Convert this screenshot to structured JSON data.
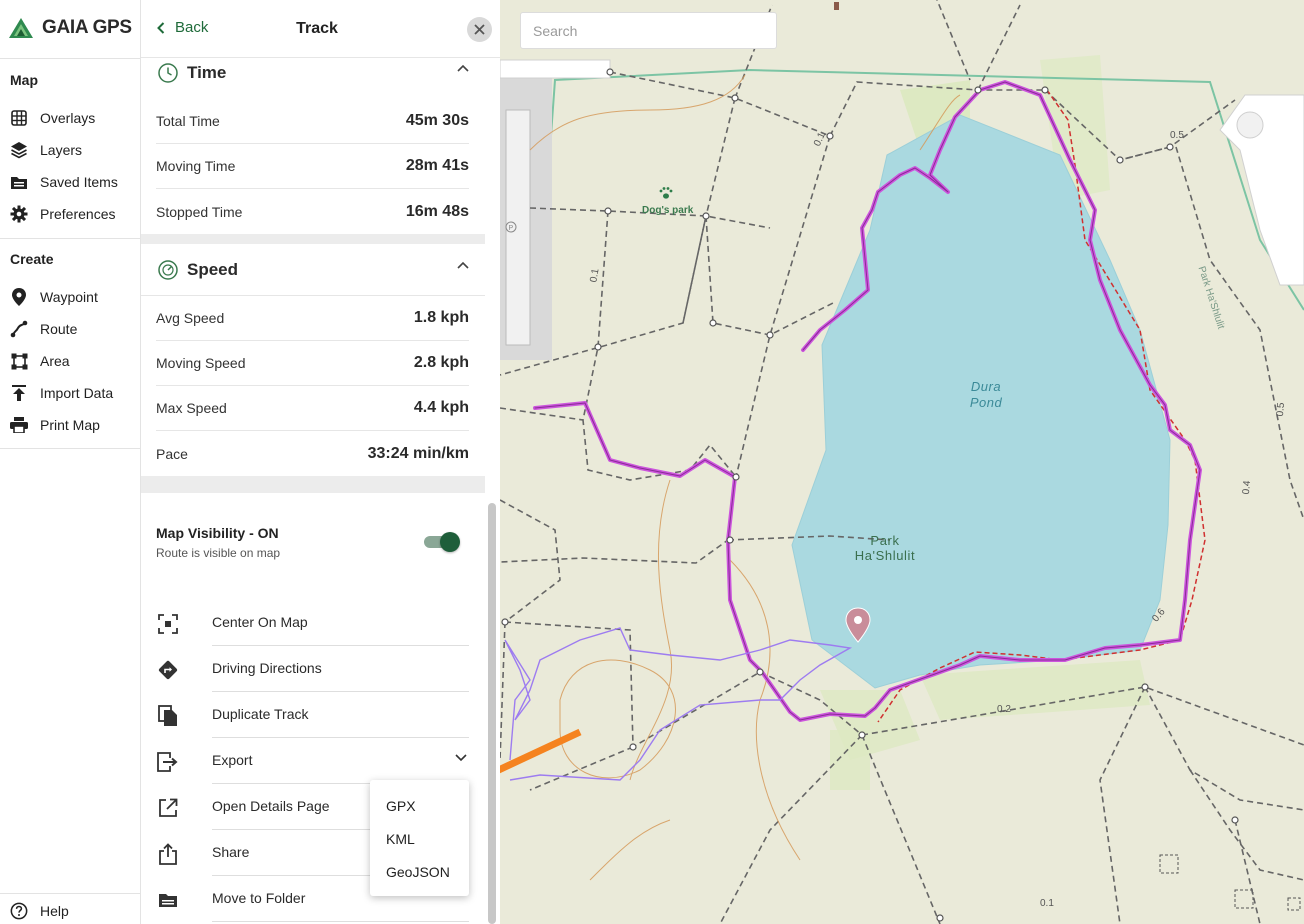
{
  "app": {
    "name": "GAIA GPS"
  },
  "sidebar": {
    "sections": [
      {
        "title": "Map",
        "items": [
          {
            "label": "Overlays",
            "icon": "overlays-icon"
          },
          {
            "label": "Layers",
            "icon": "layers-icon"
          },
          {
            "label": "Saved Items",
            "icon": "saved-items-icon"
          },
          {
            "label": "Preferences",
            "icon": "gear-icon"
          }
        ]
      },
      {
        "title": "Create",
        "items": [
          {
            "label": "Waypoint",
            "icon": "waypoint-icon"
          },
          {
            "label": "Route",
            "icon": "route-icon"
          },
          {
            "label": "Area",
            "icon": "area-icon"
          },
          {
            "label": "Import Data",
            "icon": "import-icon"
          },
          {
            "label": "Print Map",
            "icon": "print-icon"
          }
        ]
      }
    ],
    "help_label": "Help"
  },
  "panel": {
    "back_label": "Back",
    "title": "Track",
    "time_section": {
      "title": "Time",
      "rows": [
        {
          "label": "Total Time",
          "value": "45m 30s"
        },
        {
          "label": "Moving Time",
          "value": "28m 41s"
        },
        {
          "label": "Stopped Time",
          "value": "16m 48s"
        }
      ]
    },
    "speed_section": {
      "title": "Speed",
      "rows": [
        {
          "label": "Avg Speed",
          "value": "1.8 kph"
        },
        {
          "label": "Moving Speed",
          "value": "2.8 kph"
        },
        {
          "label": "Max Speed",
          "value": "4.4 kph"
        },
        {
          "label": "Pace",
          "value": "33:24 min/km"
        }
      ]
    },
    "visibility": {
      "title": "Map Visibility - ON",
      "subtitle": "Route is visible on map",
      "on": true
    },
    "actions": [
      {
        "label": "Center On Map",
        "icon": "center-icon"
      },
      {
        "label": "Driving Directions",
        "icon": "directions-icon"
      },
      {
        "label": "Duplicate Track",
        "icon": "duplicate-icon"
      },
      {
        "label": "Export",
        "icon": "export-icon"
      },
      {
        "label": "Open Details Page",
        "icon": "open-external-icon"
      },
      {
        "label": "Share",
        "icon": "share-icon"
      },
      {
        "label": "Move to Folder",
        "icon": "folder-icon"
      }
    ],
    "export_menu": [
      "GPX",
      "KML",
      "GeoJSON"
    ]
  },
  "map": {
    "search_placeholder": "Search",
    "pond_label": [
      "Dura",
      "Pond"
    ],
    "park_label": [
      "Park",
      "Ha'Shlulit"
    ],
    "dog_park_label": "Dog's park",
    "distance_labels": [
      "0.1",
      "0.5",
      "0.1",
      "0.4",
      "0.5",
      "0.6",
      "0.2",
      "0.1"
    ],
    "street_label": "Park Ha'Shlulit",
    "colors": {
      "track": "#cc55dd",
      "water": "#aad9e0",
      "land": "#eaead9",
      "accent_arrow": "#f5831f",
      "boundary": "#7cc4a4",
      "dashed_route": "#d03030"
    }
  }
}
